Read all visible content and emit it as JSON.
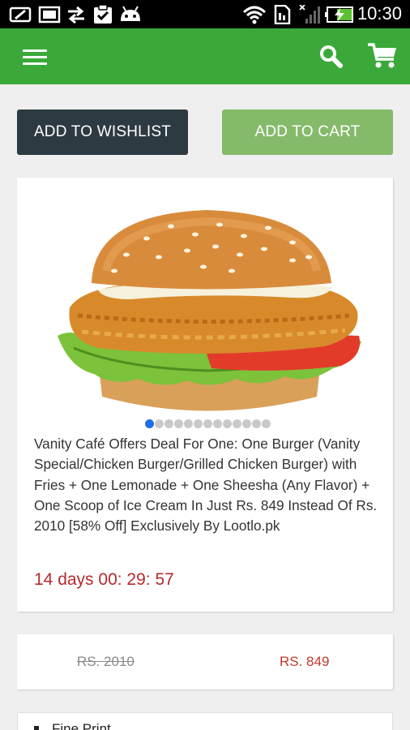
{
  "status_bar": {
    "time": "10:30",
    "icons": [
      "screen-rotate-icon",
      "image-icon",
      "sync-arrows-icon",
      "clipboard-check-icon",
      "android-icon",
      "wifi-icon",
      "sim-icon",
      "signal-off-icon",
      "battery-charging-icon"
    ]
  },
  "app_bar": {
    "color": "#3aa93a",
    "icons": [
      "menu-icon",
      "search-icon",
      "cart-icon"
    ]
  },
  "actions": {
    "wishlist_label": "ADD TO WISHLIST",
    "cart_label": "ADD TO CART"
  },
  "product": {
    "image": "burger-icon",
    "carousel": {
      "count": 13,
      "active": 1
    },
    "description": "Vanity Café Offers Deal For One: One Burger (Vanity Special/Chicken Burger/Grilled Chicken Burger) with Fries + One Lemonade + One Sheesha (Any Flavor) + One Scoop of Ice Cream In Just Rs. 849 Instead Of Rs. 2010 [58% Off] Exclusively By Lootlo.pk",
    "timer": "14 days 00: 29: 57"
  },
  "pricing": {
    "old_price": "RS. 2010",
    "new_price": "RS. 849"
  },
  "fine_print": {
    "label": "Fine Print"
  }
}
